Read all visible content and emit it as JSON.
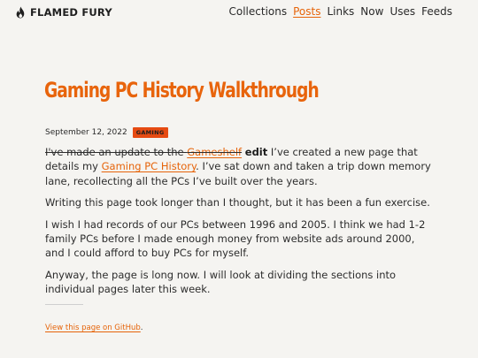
{
  "site": {
    "brand": "FLAMED FURY",
    "logo_icon": "flame-icon"
  },
  "nav": {
    "items": [
      "Collections",
      "Posts",
      "Links",
      "Now",
      "Uses",
      "Feeds"
    ],
    "active": "Posts"
  },
  "post": {
    "title": "Gaming PC History Walkthrough",
    "date": "September 12, 2022",
    "tag": "GAMING",
    "p1_strike": "I've made an update to the ",
    "p1_strike_link": "Gameshelf",
    "p1_edit": "edit",
    "p1_text_a": " I’ve created a new page that details my ",
    "p1_link": "Gaming PC History",
    "p1_text_b": ". I’ve sat down and taken a trip down memory lane, recollecting all the PCs I’ve built over the years.",
    "p2": "Writing this page took longer than I thought, but it has been a fun exercise.",
    "p3": "I wish I had records of our PCs between 1996 and 2005. I think we had 1-2 family PCs before I made enough money from website ads around 2000, and I could afford to buy PCs for myself.",
    "p4": "Anyway, the page is long now. I will look at dividing the sections into individual pages later this week."
  },
  "footer": {
    "github_link": "View this page on GitHub",
    "github_suffix": "."
  },
  "colors": {
    "accent": "#e6640a",
    "tag_bg": "#e64b12",
    "background": "#f5f4f1"
  }
}
